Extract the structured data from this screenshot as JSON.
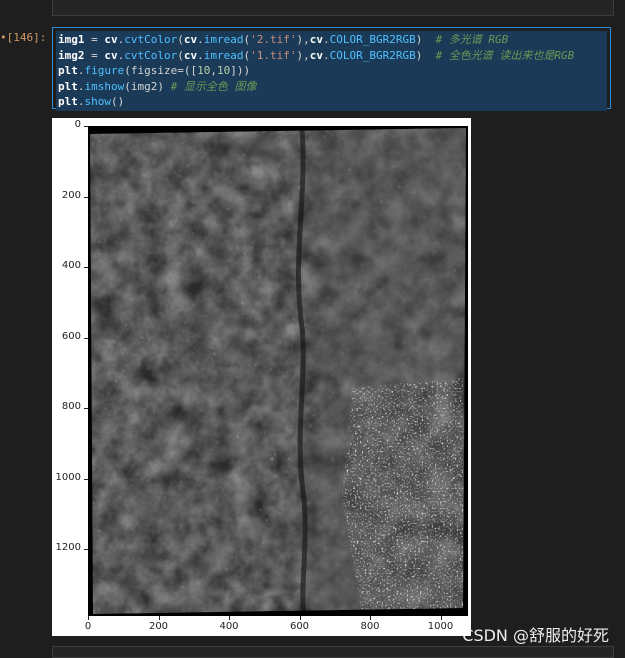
{
  "cell": {
    "prompt": "•[146]:",
    "code_lines": [
      [
        [
          "v",
          "img1"
        ],
        [
          "o",
          " = "
        ],
        [
          "k",
          "cv"
        ],
        [
          "o",
          "."
        ],
        [
          "f",
          "cvtColor"
        ],
        [
          "o",
          "("
        ],
        [
          "k",
          "cv"
        ],
        [
          "o",
          "."
        ],
        [
          "f",
          "imread"
        ],
        [
          "o",
          "("
        ],
        [
          "s",
          "'2.tif'"
        ],
        [
          "o",
          "),"
        ],
        [
          "k",
          "cv"
        ],
        [
          "o",
          "."
        ],
        [
          "f",
          "COLOR_BGR2RGB"
        ],
        [
          "o",
          ")  "
        ],
        [
          "c",
          "# 多光谱 RGB"
        ]
      ],
      [
        [
          "v",
          "img2"
        ],
        [
          "o",
          " = "
        ],
        [
          "k",
          "cv"
        ],
        [
          "o",
          "."
        ],
        [
          "f",
          "cvtColor"
        ],
        [
          "o",
          "("
        ],
        [
          "k",
          "cv"
        ],
        [
          "o",
          "."
        ],
        [
          "f",
          "imread"
        ],
        [
          "o",
          "("
        ],
        [
          "s",
          "'1.tif'"
        ],
        [
          "o",
          "),"
        ],
        [
          "k",
          "cv"
        ],
        [
          "o",
          "."
        ],
        [
          "f",
          "COLOR_BGR2RGB"
        ],
        [
          "o",
          ")  "
        ],
        [
          "c",
          "# 全色光谱 读出来也是RGB"
        ]
      ],
      [
        [
          "k",
          "plt"
        ],
        [
          "o",
          "."
        ],
        [
          "f",
          "figure"
        ],
        [
          "o",
          "(figsize=(["
        ],
        [
          "n",
          "10"
        ],
        [
          "o",
          ","
        ],
        [
          "n",
          "10"
        ],
        [
          "o",
          "]))"
        ]
      ],
      [
        [
          "k",
          "plt"
        ],
        [
          "o",
          "."
        ],
        [
          "f",
          "imshow"
        ],
        [
          "o",
          "(img2) "
        ],
        [
          "c",
          "# 显示全色 图像"
        ]
      ],
      [
        [
          "k",
          "plt"
        ],
        [
          "o",
          "."
        ],
        [
          "f",
          "show"
        ],
        [
          "o",
          "()"
        ]
      ]
    ]
  },
  "figure": {
    "y_ticks": [
      "0",
      "200",
      "400",
      "600",
      "800",
      "1000",
      "1200"
    ],
    "x_ticks": [
      "0",
      "200",
      "400",
      "600",
      "800",
      "1000"
    ],
    "image_label": "panchromatic satellite image (grayscale terrain with city in lower right)"
  },
  "watermark": "CSDN @舒服的好死"
}
